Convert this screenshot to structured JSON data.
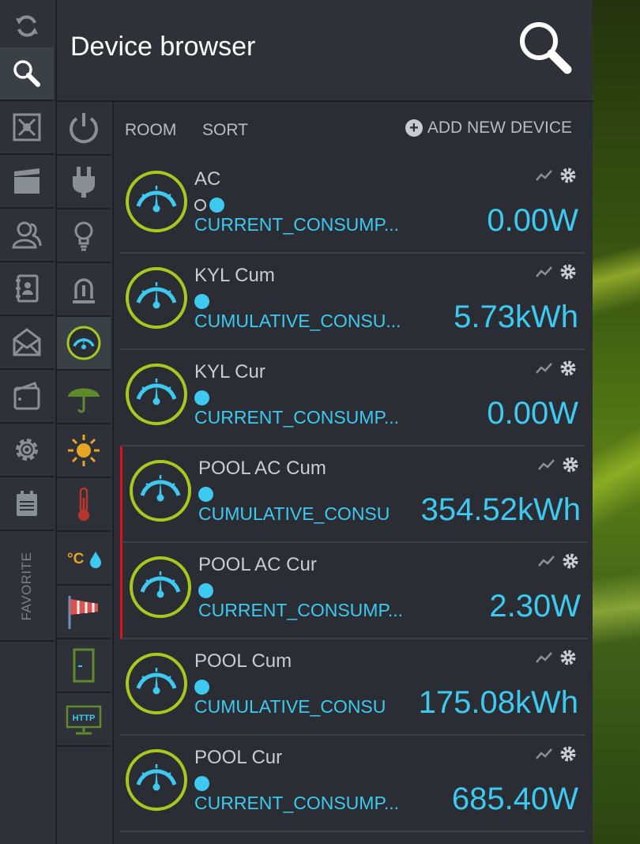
{
  "header": {
    "title": "Device browser"
  },
  "sidebar": {
    "items": [
      {
        "icon": "refresh-icon"
      },
      {
        "icon": "search-icon"
      },
      {
        "icon": "scenes-icon"
      },
      {
        "icon": "clapperboard-icon"
      },
      {
        "icon": "users-icon"
      },
      {
        "icon": "contacts-icon"
      },
      {
        "icon": "mail-icon"
      },
      {
        "icon": "wallet-icon"
      },
      {
        "icon": "gear-icon"
      },
      {
        "icon": "calendar-icon"
      }
    ],
    "favorite_label": "FAVORITE"
  },
  "categories": {
    "items": [
      {
        "icon": "power-icon"
      },
      {
        "icon": "plug-icon"
      },
      {
        "icon": "bulb-icon"
      },
      {
        "icon": "siren-icon"
      },
      {
        "icon": "meter-icon"
      },
      {
        "icon": "umbrella-icon"
      },
      {
        "icon": "sun-icon"
      },
      {
        "icon": "thermometer-icon"
      },
      {
        "icon": "temp-humidity-icon",
        "label": "°C"
      },
      {
        "icon": "windsock-icon"
      },
      {
        "icon": "door-icon"
      },
      {
        "icon": "http-icon",
        "label": "HTTP"
      }
    ]
  },
  "toolbar": {
    "room_label": "ROOM",
    "sort_label": "SORT",
    "add_label": "ADD NEW DEVICE",
    "add_symbol": "+"
  },
  "devices": [
    {
      "name": "AC",
      "param": "CURRENT_CONSUMP...",
      "value": "0.00W",
      "alert": false
    },
    {
      "name": "KYL Cum",
      "param": "CUMULATIVE_CONSU...",
      "value": "5.73kWh",
      "alert": false
    },
    {
      "name": "KYL Cur",
      "param": "CURRENT_CONSUMP...",
      "value": "0.00W",
      "alert": false
    },
    {
      "name": "POOL AC Cum",
      "param": "CUMULATIVE_CONSU",
      "value": "354.52kWh",
      "alert": true
    },
    {
      "name": "POOL AC Cur",
      "param": "CURRENT_CONSUMP...",
      "value": "2.30W",
      "alert": true
    },
    {
      "name": "POOL Cum",
      "param": "CUMULATIVE_CONSU",
      "value": "175.08kWh",
      "alert": false
    },
    {
      "name": "POOL Cur",
      "param": "CURRENT_CONSUMP...",
      "value": "685.40W",
      "alert": false
    }
  ],
  "colors": {
    "accent": "#3ec9f0",
    "gauge_ring": "#a8c81e",
    "alert": "#e2101a"
  }
}
